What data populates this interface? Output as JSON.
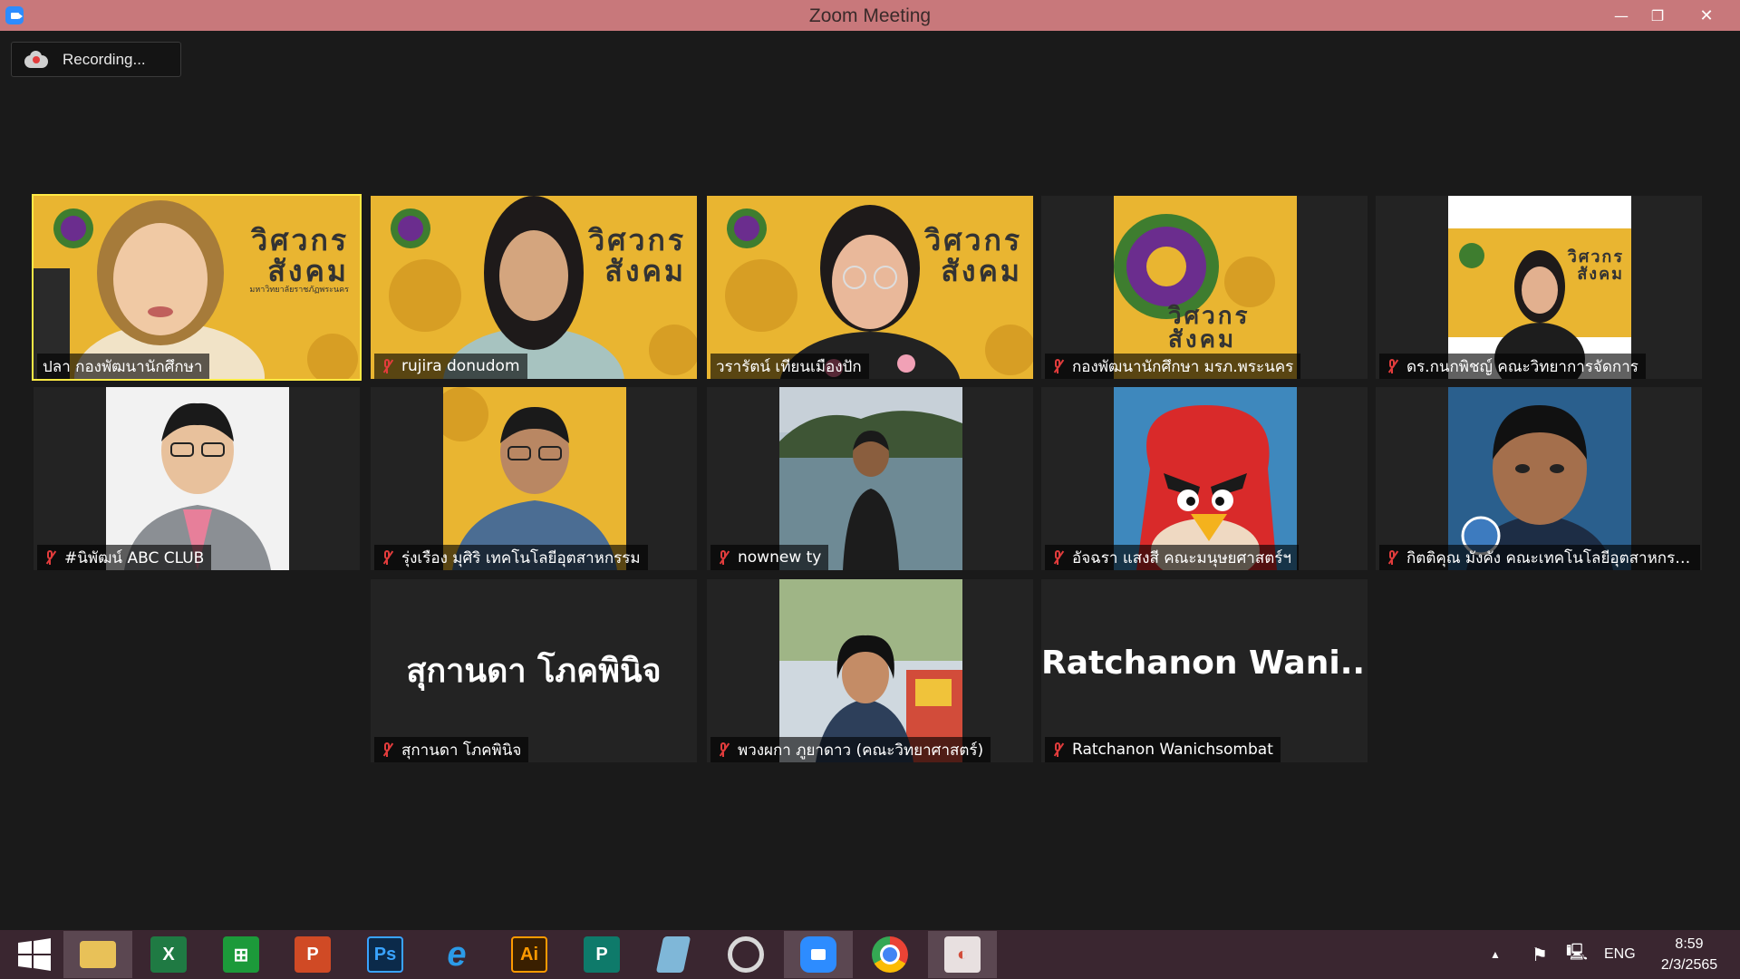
{
  "window": {
    "title": "Zoom Meeting",
    "minimize": "—",
    "restore": "❐",
    "close": "✕"
  },
  "recording": {
    "label": "Recording..."
  },
  "participants": [
    {
      "name": "ปลา กองพัฒนานักศึกษา",
      "muted": false,
      "active_speaker": true
    },
    {
      "name": "rujira donudom",
      "muted": true
    },
    {
      "name": "วรารัตน์ เทียนเมืองปัก",
      "muted": false
    },
    {
      "name": "กองพัฒนานักศึกษา มรภ.พระนคร",
      "muted": true
    },
    {
      "name": "ดร.กนกพิชญ์ คณะวิทยาการจัดการ",
      "muted": true
    },
    {
      "name": "#นิพัฒน์ ABC CLUB",
      "muted": true
    },
    {
      "name": "รุ่งเรือง มุศิริ เทคโนโลยีอุตสาหกรรม",
      "muted": true
    },
    {
      "name": "nownew ty",
      "muted": true
    },
    {
      "name": "อัจฉรา แสงสี คณะมนุษยศาสตร์ฯ",
      "muted": true
    },
    {
      "name": "กิตติคุณ มังคัง คณะเทคโนโลยีอุตสาหกรรม",
      "muted": true
    },
    {
      "name": "สุกานดา โภคพินิจ",
      "muted": true,
      "display_text": "สุกานดา โภคพินิจ"
    },
    {
      "name": "พวงผกา ภูยาดาว (คณะวิทยาศาสตร์)",
      "muted": true
    },
    {
      "name": "Ratchanon Wanichsombat",
      "muted": true,
      "display_text": "Ratchanon Wani..."
    }
  ],
  "poster": {
    "title_line1": "วิศวกร",
    "title_line2": "สังคม",
    "university": "มหาวิทยาลัยราชภัฏพระนคร"
  },
  "taskbar": {
    "apps": [
      "start",
      "file-explorer",
      "excel",
      "store",
      "powerpoint",
      "photoshop",
      "internet-explorer",
      "illustrator",
      "publisher",
      "notepad",
      "photoscape",
      "zoom",
      "chrome",
      "office"
    ],
    "app_labels": {
      "excel": "X",
      "powerpoint": "P",
      "photoshop": "Ps",
      "illustrator": "Ai",
      "publisher": "P"
    },
    "language": "ENG",
    "time": "8:59",
    "date": "2/3/2565"
  },
  "colors": {
    "titlebar": "#c8787b",
    "meeting_bg": "#1a1a1a",
    "active_border": "#ffea45",
    "mute_red": "#e23c3c",
    "poster_yellow": "#e9b531",
    "taskbar": "#3a2630"
  }
}
